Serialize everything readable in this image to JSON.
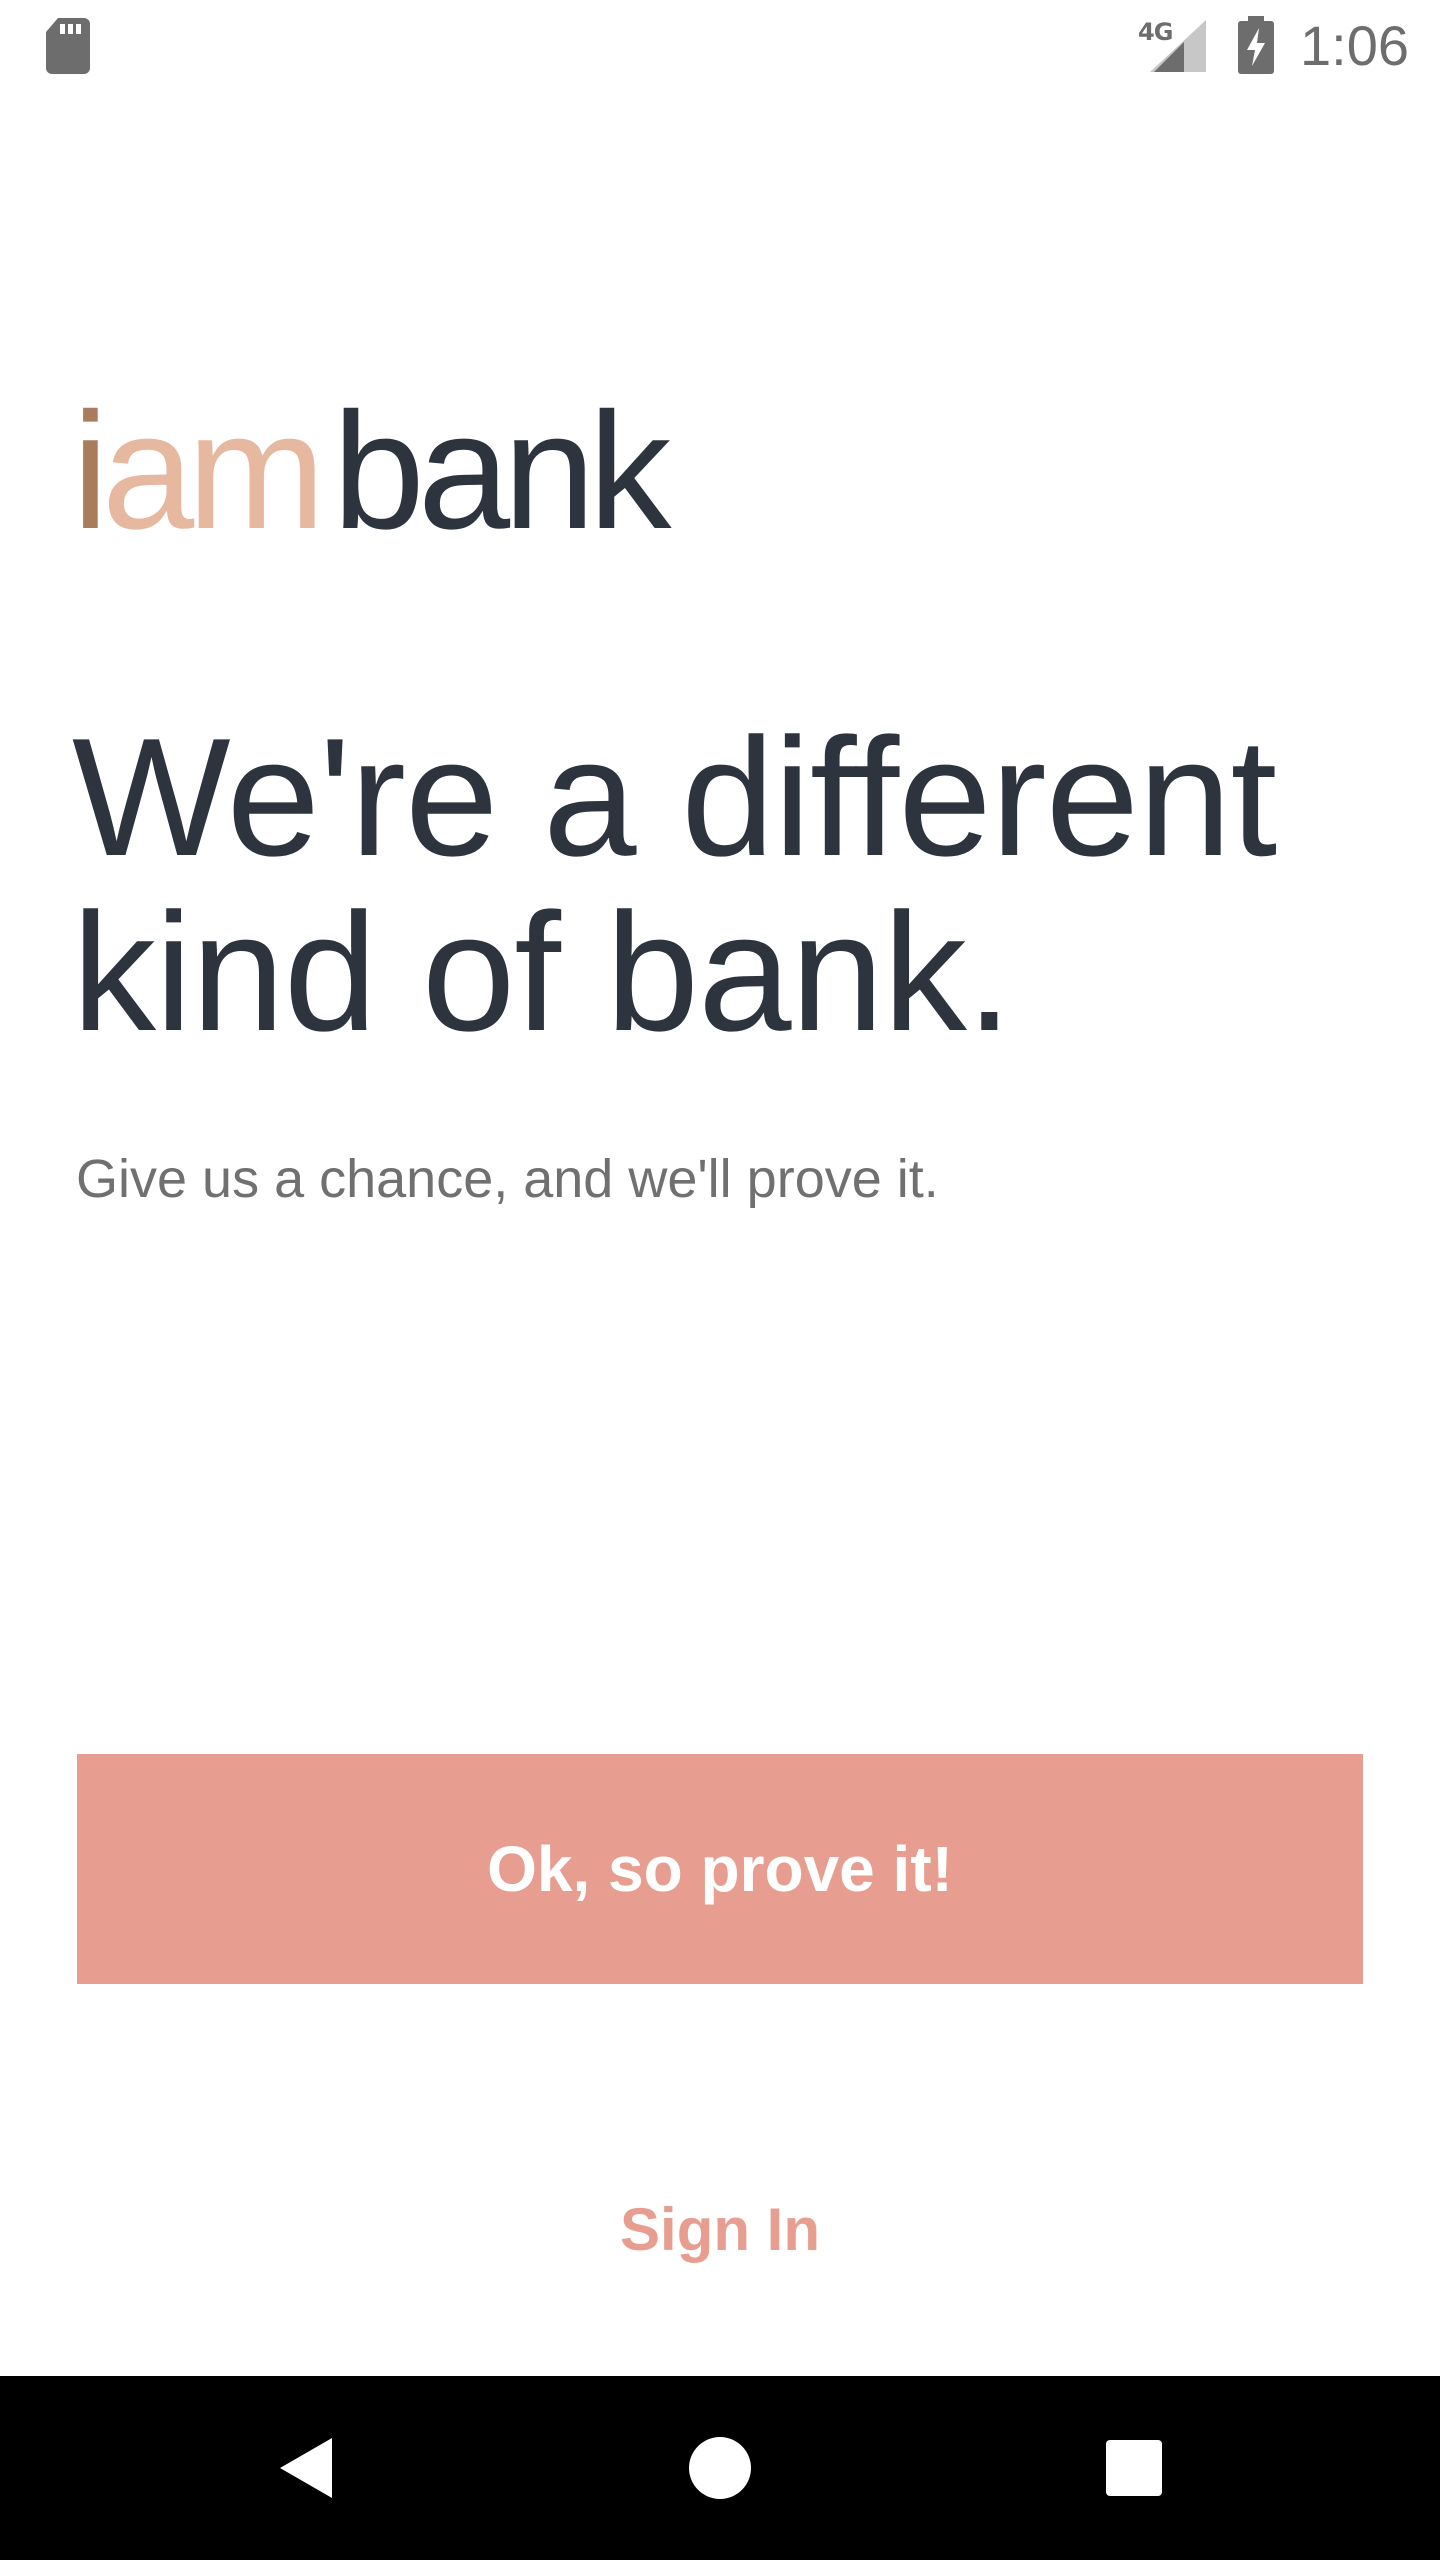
{
  "status_bar": {
    "network_label": "4G",
    "time": "1:06",
    "icons": [
      "sd-card-icon",
      "signal-icon",
      "battery-charging-icon"
    ]
  },
  "logo": {
    "part_i": "i",
    "part_am": "am",
    "part_bank": "bank",
    "colors": {
      "i": "#a97d5c",
      "am": "#e6b8a0",
      "bank": "#2e343e"
    }
  },
  "hero": {
    "headline_line1": "We're a different",
    "headline_line2": "kind of bank.",
    "subtext": "Give us a chance, and we'll prove it."
  },
  "actions": {
    "primary_label": "Ok, so prove it!",
    "secondary_label": "Sign In",
    "accent_color": "#e79e91"
  },
  "nav_bar": {
    "icons": [
      "back-icon",
      "home-icon",
      "recents-icon"
    ]
  }
}
